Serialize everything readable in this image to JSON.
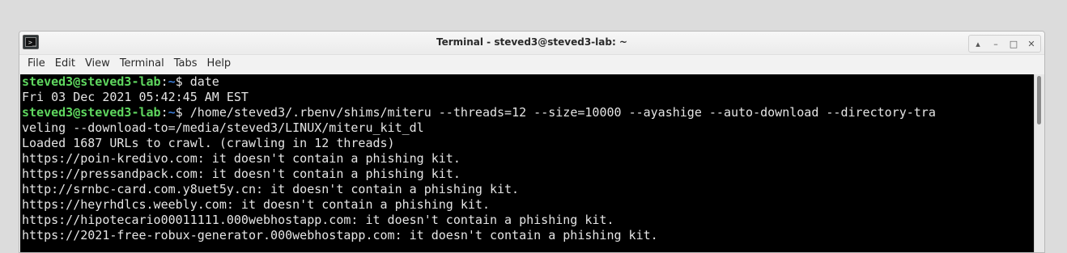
{
  "window": {
    "title": "Terminal - steved3@steved3-lab: ~",
    "controls": [
      "maximize-up-icon",
      "minimize-icon",
      "restore-icon",
      "close-icon"
    ]
  },
  "menubar": {
    "items": [
      "File",
      "Edit",
      "View",
      "Terminal",
      "Tabs",
      "Help"
    ]
  },
  "terminal": {
    "prompt_user": "steved3@steved3-lab",
    "prompt_path": "~",
    "prompt_symbol": "$",
    "lines": [
      {
        "type": "prompt",
        "command": " date"
      },
      {
        "type": "output",
        "text": "Fri 03 Dec 2021 05:42:45 AM EST"
      },
      {
        "type": "prompt",
        "command": " /home/steved3/.rbenv/shims/miteru --threads=12 --size=10000 --ayashige --auto-download --directory-tra"
      },
      {
        "type": "output",
        "text": "veling --download-to=/media/steved3/LINUX/miteru_kit_dl"
      },
      {
        "type": "output",
        "text": "Loaded 1687 URLs to crawl. (crawling in 12 threads)"
      },
      {
        "type": "output",
        "text": "https://poin-kredivo.com: it doesn't contain a phishing kit."
      },
      {
        "type": "output",
        "text": "https://pressandpack.com: it doesn't contain a phishing kit."
      },
      {
        "type": "output",
        "text": "http://srnbc-card.com.y8uet5y.cn: it doesn't contain a phishing kit."
      },
      {
        "type": "output",
        "text": "https://heyrhdlcs.weebly.com: it doesn't contain a phishing kit."
      },
      {
        "type": "output",
        "text": "https://hipotecario00011111.000webhostapp.com: it doesn't contain a phishing kit."
      },
      {
        "type": "output",
        "text": "https://2021-free-robux-generator.000webhostapp.com: it doesn't contain a phishing kit."
      }
    ]
  },
  "colors": {
    "terminal_bg": "#000000",
    "terminal_fg": "#e5e5e5",
    "prompt_user": "#5fd75f",
    "prompt_path": "#3a7bd5"
  }
}
